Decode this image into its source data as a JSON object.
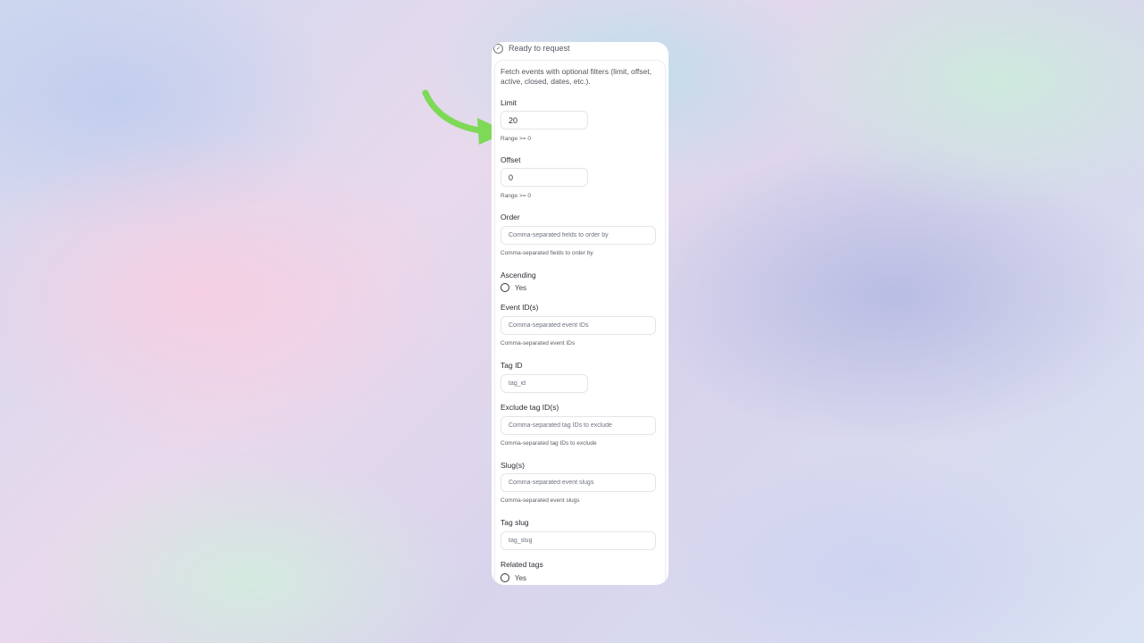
{
  "status": {
    "text": "Ready to request",
    "icon": "check-circle-icon"
  },
  "description": "Fetch events with optional filters (limit, offset, active, closed, dates, etc.).",
  "fields": {
    "limit": {
      "label": "Limit",
      "value": "20",
      "hint": "Range >= 0"
    },
    "offset": {
      "label": "Offset",
      "value": "0",
      "hint": "Range >= 0"
    },
    "order": {
      "label": "Order",
      "placeholder": "Comma-separated fields to order by",
      "hint": "Comma-separated fields to order by"
    },
    "ascending": {
      "label": "Ascending",
      "option": "Yes"
    },
    "event_ids": {
      "label": "Event ID(s)",
      "placeholder": "Comma-separated event IDs",
      "hint": "Comma-separated event IDs"
    },
    "tag_id": {
      "label": "Tag ID",
      "placeholder": "tag_id"
    },
    "exclude_tag_ids": {
      "label": "Exclude tag ID(s)",
      "placeholder": "Comma-separated tag IDs to exclude",
      "hint": "Comma-separated tag IDs to exclude"
    },
    "slugs": {
      "label": "Slug(s)",
      "placeholder": "Comma-separated event slugs",
      "hint": "Comma-separated event slugs"
    },
    "tag_slug": {
      "label": "Tag slug",
      "placeholder": "tag_slug"
    },
    "related_tags": {
      "label": "Related tags",
      "option": "Yes"
    }
  },
  "colors": {
    "arrow": "#7ed957",
    "card": "#ffffff"
  }
}
